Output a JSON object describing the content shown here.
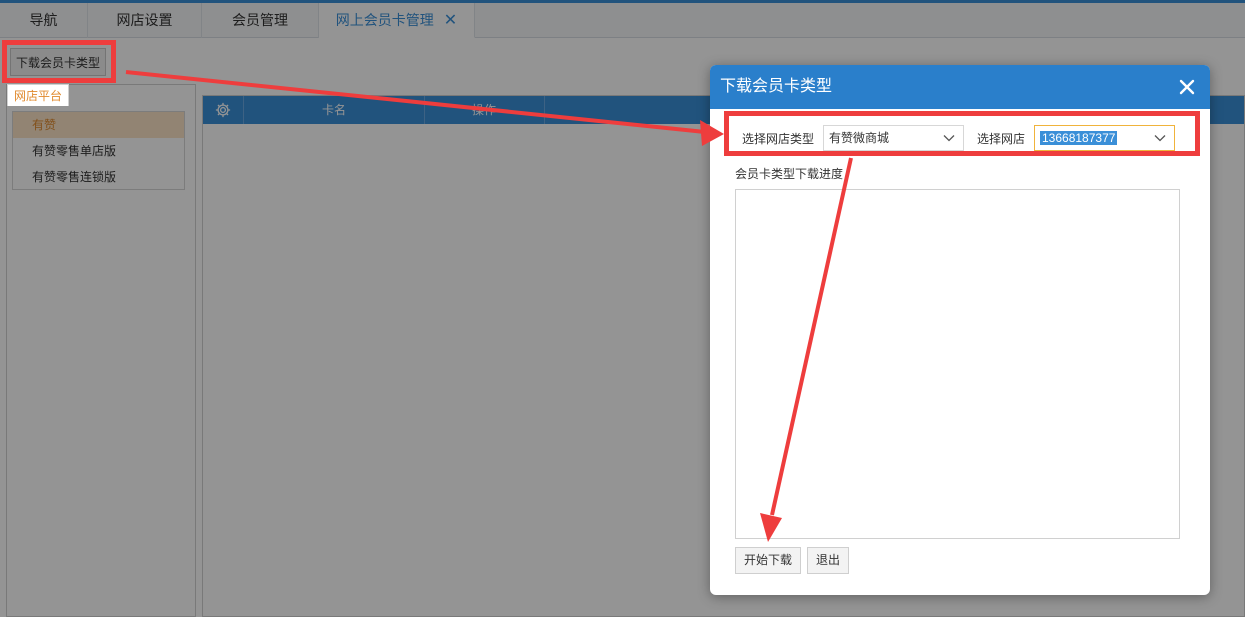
{
  "tabs": [
    {
      "label": "导航"
    },
    {
      "label": "网店设置"
    },
    {
      "label": "会员管理"
    },
    {
      "label": "网上会员卡管理",
      "active": true
    }
  ],
  "toolbar": {
    "download_button": "下载会员卡类型"
  },
  "left_panel": {
    "tab_label": "网店平台",
    "items": [
      "有赞",
      "有赞零售单店版",
      "有赞零售连锁版"
    ],
    "selected_index": 0
  },
  "grid": {
    "columns": [
      "卡名",
      "操作"
    ],
    "gear_icon": "gear-icon"
  },
  "dialog": {
    "title": "下载会员卡类型",
    "close_icon": "close-icon",
    "shop_type_label": "选择网店类型",
    "shop_type_value": "有赞微商城",
    "shop_label": "选择网店",
    "shop_value": "13668187377",
    "progress_label": "会员卡类型下载进度",
    "start_button": "开始下载",
    "exit_button": "退出"
  },
  "colors": {
    "accent": "#3a8fd8",
    "dialog_header": "#2a7fcb",
    "annotation_red": "#ee3d3d",
    "selected_orange": "#e08a2e"
  }
}
